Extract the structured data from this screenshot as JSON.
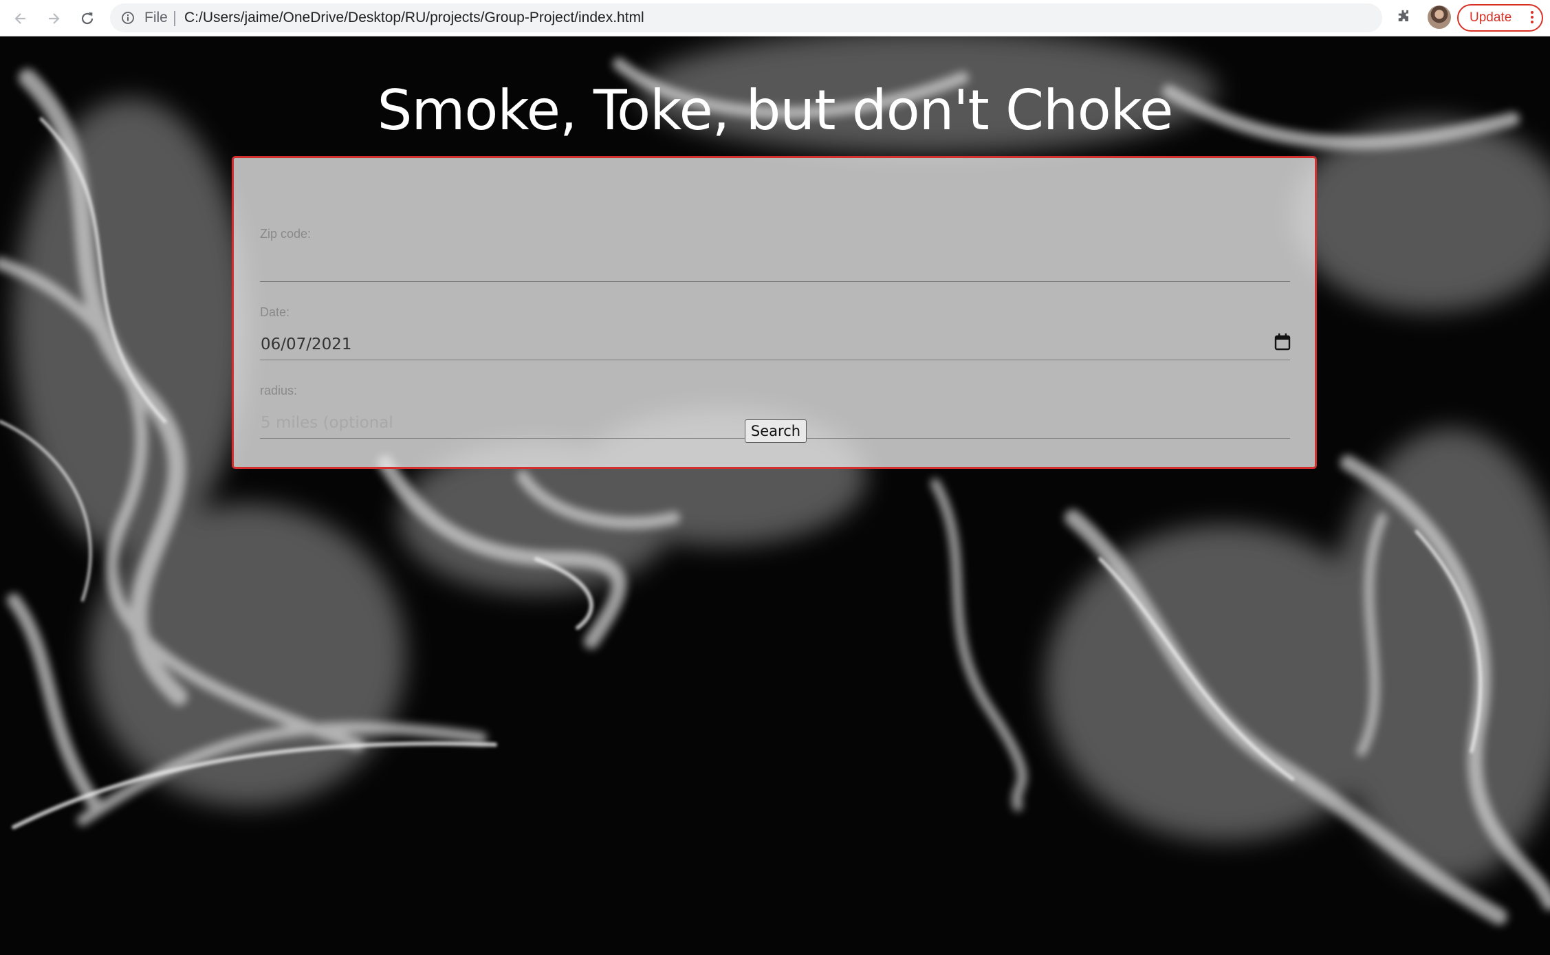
{
  "browser": {
    "scheme_label": "File",
    "url": "C:/Users/jaime/OneDrive/Desktop/RU/projects/Group-Project/index.html",
    "update_label": "Update",
    "icons": [
      "back-icon",
      "forward-icon",
      "reload-icon",
      "info-icon",
      "star-icon",
      "extensions-icon",
      "avatar",
      "menu-icon"
    ]
  },
  "page": {
    "title": "Smoke, Toke, but don't Choke",
    "form": {
      "zip": {
        "label": "Zip code:",
        "value": "",
        "placeholder": ""
      },
      "date": {
        "label": "Date:",
        "value": "06/07/2021"
      },
      "radius": {
        "label": "radius:",
        "value": "",
        "placeholder": "5 miles (optional"
      },
      "search_label": "Search"
    }
  },
  "colors": {
    "card_border": "#d32f2f",
    "update_accent": "#d93025",
    "background": "#050505",
    "title_text": "#ffffff"
  }
}
